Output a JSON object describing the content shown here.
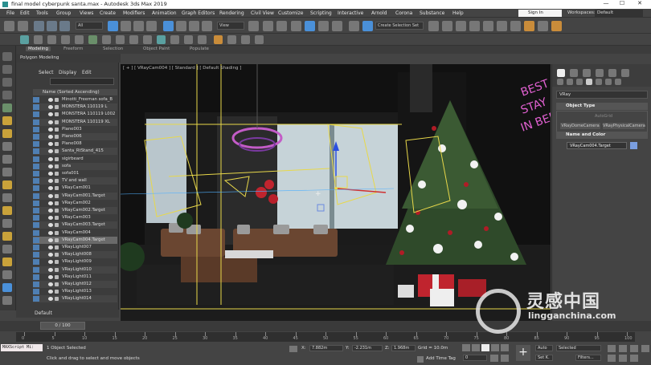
{
  "window": {
    "title": "final model cyberpunk santa.max - Autodesk 3ds Max 2019"
  },
  "menu": {
    "items": [
      "File",
      "Edit",
      "Tools",
      "Group",
      "Views",
      "Create",
      "Modifiers",
      "Animation",
      "Graph Editors",
      "Rendering",
      "Civil View",
      "Customize",
      "Scripting",
      "Interactive",
      "Arnold",
      "Corona",
      "Substance",
      "Help"
    ],
    "sign_in": "Sign In",
    "workspaces_label": "Workspaces:",
    "workspace": "Default"
  },
  "toolbar": {
    "filter": "All",
    "ref_coord": "View",
    "selection_set": "Create Selection Set",
    "accent": "#4a90d9"
  },
  "ribbon": {
    "tabs": [
      "Modeling",
      "Freeform",
      "Selection",
      "Object Paint",
      "Populate"
    ],
    "active": "Modeling",
    "sub": "Polygon Modeling"
  },
  "explorer": {
    "tabs": [
      "Select",
      "Display",
      "Edit"
    ],
    "header": "Name (Sorted Ascending)",
    "rows": [
      "Minotti_Freeman sofa_B",
      "MONSTERA 110119 L",
      "MONSTERA 110119 L002",
      "MONSTERA 110119 XL",
      "Plane003",
      "Plane006",
      "Plane008",
      "Santa_RtStand_415",
      "sigirbeard",
      "sofa",
      "sofa001",
      "TV and wall",
      "VRayCam001",
      "VRayCam001.Target",
      "VRayCam002",
      "VRayCam002.Target",
      "VRayCam003",
      "VRayCam003.Target",
      "VRayCam004",
      "VRayCam004.Target",
      "VRayLight007",
      "VRayLight008",
      "VRayLight009",
      "VRayLight010",
      "VRayLight011",
      "VRayLight012",
      "VRayLight013",
      "VRayLight014"
    ],
    "selected": "VRayCam004.Target",
    "layer": "Default"
  },
  "viewport": {
    "label": "[ + ] [ VRayCam004 ] [ Standard ] [ Default Shading ]"
  },
  "command_panel": {
    "category": "VRay",
    "object_type": "Object Type",
    "autogrid": "AutoGrid",
    "buttons": [
      "VRayDomeCamera",
      "VRayPhysicalCamera"
    ],
    "name_and_color": "Name and Color",
    "object_name": "VRayCam004.Target",
    "object_color": "#7a9ee0"
  },
  "time": {
    "slider": "0 / 100",
    "ticks": [
      "0",
      "5",
      "10",
      "15",
      "20",
      "25",
      "30",
      "35",
      "40",
      "45",
      "50",
      "55",
      "60",
      "65",
      "70",
      "75",
      "80",
      "85",
      "90",
      "95",
      "100"
    ]
  },
  "status": {
    "script": "MAXScript Mi:",
    "selected": "1 Object Selected",
    "prompt": "Click and drag to select and move objects",
    "x_label": "X:",
    "x": "7.882m",
    "y_label": "Y:",
    "y": "-2.231m",
    "z_label": "Z:",
    "z": "1.968m",
    "grid": "Grid = 10.0m",
    "add_time_tag": "Add Time Tag",
    "auto": "Auto",
    "set_k": "Set K.",
    "selected_dd": "Selected",
    "filters": "Filters...",
    "frame": "0"
  },
  "watermark": {
    "text": "灵感中国",
    "url": "lingganchina.com"
  }
}
